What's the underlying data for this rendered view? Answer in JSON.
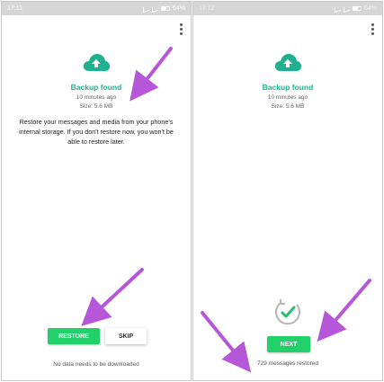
{
  "left_screen": {
    "status": {
      "time": "17:11",
      "battery": "64%"
    },
    "title": "Backup found",
    "backup_time": "10 minutes ago",
    "backup_size": "Size: 5.6 MB",
    "description": "Restore your messages and media from your phone's internal storage. If you don't restore now, you won't be able to restore later.",
    "restore_label": "RESTORE",
    "skip_label": "SKIP",
    "footnote": "No data needs to be downloaded"
  },
  "right_screen": {
    "status": {
      "time": "17:12",
      "battery": "64%"
    },
    "title": "Backup found",
    "backup_time": "10 minutes ago",
    "backup_size": "Size: 5.6 MB",
    "next_label": "NEXT",
    "restored_text": "729 messages restored"
  },
  "colors": {
    "accent": "#1fb08f",
    "button_green": "#22d06a",
    "annotation_arrow": "#b557d8"
  },
  "icons": [
    "cloud-upload-icon",
    "more-vert-icon",
    "restore-check-icon",
    "annotation-arrow"
  ]
}
